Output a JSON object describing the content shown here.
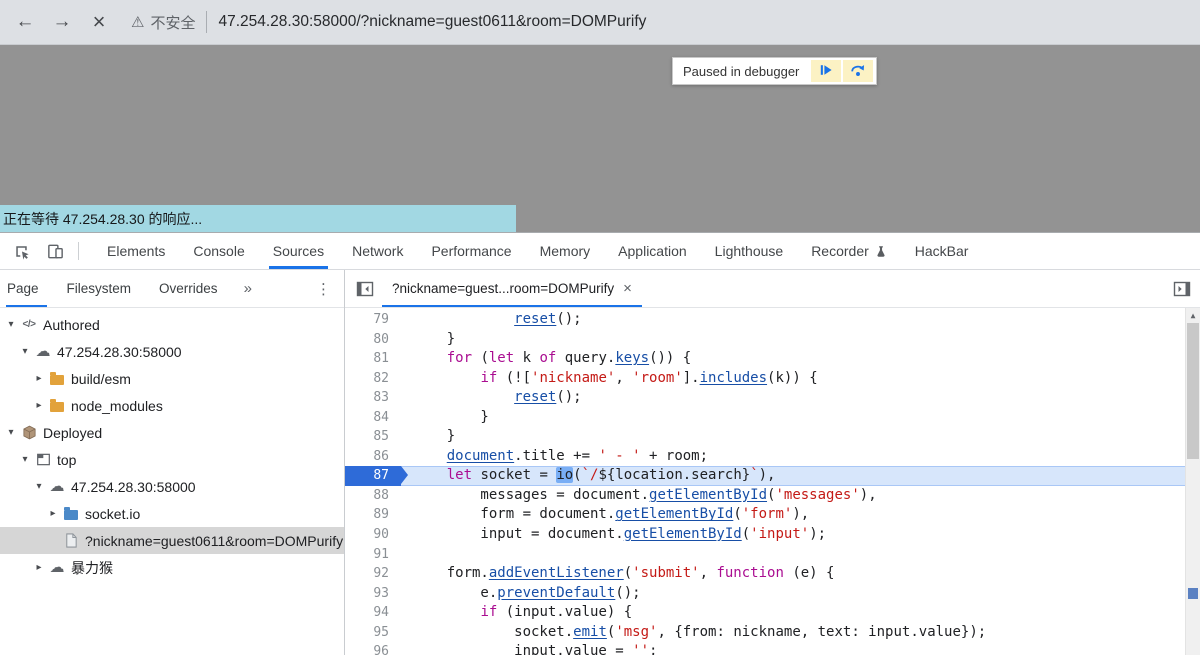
{
  "browser": {
    "security_label": "不安全",
    "url": "47.254.28.30:58000/?nickname=guest0611&room=DOMPurify"
  },
  "page": {
    "paused_label": "Paused in debugger",
    "status_text": "正在等待 47.254.28.30 的响应..."
  },
  "icons": {
    "back": "←",
    "forward": "→",
    "stop": "×",
    "warning": "⚠",
    "overflow": "»",
    "kebab": "⋮",
    "scroll_up": "▲",
    "close": "×"
  },
  "devtools": {
    "main_tabs": [
      {
        "label": "Elements"
      },
      {
        "label": "Console"
      },
      {
        "label": "Sources",
        "active": true
      },
      {
        "label": "Network"
      },
      {
        "label": "Performance"
      },
      {
        "label": "Memory"
      },
      {
        "label": "Application"
      },
      {
        "label": "Lighthouse"
      },
      {
        "label": "Recorder",
        "badge": true
      },
      {
        "label": "HackBar"
      }
    ],
    "sidebar_tabs": [
      {
        "label": "Page",
        "active": true
      },
      {
        "label": "Filesystem"
      },
      {
        "label": "Overrides"
      }
    ],
    "tree": [
      {
        "depth": 0,
        "exp": "▾",
        "icon": "code",
        "label": "Authored"
      },
      {
        "depth": 1,
        "exp": "▾",
        "icon": "cloud",
        "label": "47.254.28.30:58000"
      },
      {
        "depth": 2,
        "exp": "▸",
        "icon": "folder-orange",
        "label": "build/esm"
      },
      {
        "depth": 2,
        "exp": "▸",
        "icon": "folder-orange",
        "label": "node_modules"
      },
      {
        "depth": 0,
        "exp": "▾",
        "icon": "package",
        "label": "Deployed"
      },
      {
        "depth": 1,
        "exp": "▾",
        "icon": "frame",
        "label": "top"
      },
      {
        "depth": 2,
        "exp": "▾",
        "icon": "cloud",
        "label": "47.254.28.30:58000"
      },
      {
        "depth": 3,
        "exp": "▸",
        "icon": "folder-blue",
        "label": "socket.io"
      },
      {
        "depth": 3,
        "exp": "",
        "icon": "file",
        "label": "?nickname=guest0611&room=DOMPurify",
        "selected": true
      },
      {
        "depth": 2,
        "exp": "▸",
        "icon": "cloud",
        "label": "暴力猴"
      }
    ],
    "editor": {
      "tab_label": "?nickname=guest...room=DOMPurify",
      "current_line": 87,
      "code_lines": [
        {
          "n": 79,
          "t": [
            [
              "t",
              "            "
            ],
            [
              "u",
              "reset"
            ],
            [
              "t",
              "();"
            ]
          ]
        },
        {
          "n": 80,
          "t": [
            [
              "t",
              "    }"
            ]
          ]
        },
        {
          "n": 81,
          "t": [
            [
              "t",
              "    "
            ],
            [
              "k",
              "for"
            ],
            [
              "t",
              " ("
            ],
            [
              "k",
              "let"
            ],
            [
              "t",
              " k "
            ],
            [
              "k",
              "of"
            ],
            [
              "t",
              " query."
            ],
            [
              "u",
              "keys"
            ],
            [
              "t",
              "()) {"
            ]
          ]
        },
        {
          "n": 82,
          "t": [
            [
              "t",
              "        "
            ],
            [
              "k",
              "if"
            ],
            [
              "t",
              " (!["
            ],
            [
              "s",
              "'nickname'"
            ],
            [
              "t",
              ", "
            ],
            [
              "s",
              "'room'"
            ],
            [
              "t",
              "]."
            ],
            [
              "u",
              "includes"
            ],
            [
              "t",
              "(k)) {"
            ]
          ]
        },
        {
          "n": 83,
          "t": [
            [
              "t",
              "            "
            ],
            [
              "u",
              "reset"
            ],
            [
              "t",
              "();"
            ]
          ]
        },
        {
          "n": 84,
          "t": [
            [
              "t",
              "        }"
            ]
          ]
        },
        {
          "n": 85,
          "t": [
            [
              "t",
              "    }"
            ]
          ]
        },
        {
          "n": 86,
          "t": [
            [
              "t",
              "    "
            ],
            [
              "u",
              "document"
            ],
            [
              "t",
              ".title += "
            ],
            [
              "s",
              "' - '"
            ],
            [
              "t",
              " + room;"
            ]
          ]
        },
        {
          "n": 87,
          "current": true,
          "t": [
            [
              "t",
              "    "
            ],
            [
              "k",
              "let"
            ],
            [
              "t",
              " socket = "
            ],
            [
              "cur",
              "io"
            ],
            [
              "t",
              "("
            ],
            [
              "s",
              "`/"
            ],
            [
              "t",
              "${location.search}"
            ],
            [
              "s",
              "`"
            ],
            [
              "t",
              "),"
            ]
          ]
        },
        {
          "n": 88,
          "t": [
            [
              "t",
              "        messages = document."
            ],
            [
              "u",
              "getElementById"
            ],
            [
              "t",
              "("
            ],
            [
              "s",
              "'messages'"
            ],
            [
              "t",
              "),"
            ]
          ]
        },
        {
          "n": 89,
          "t": [
            [
              "t",
              "        form = document."
            ],
            [
              "u",
              "getElementById"
            ],
            [
              "t",
              "("
            ],
            [
              "s",
              "'form'"
            ],
            [
              "t",
              "),"
            ]
          ]
        },
        {
          "n": 90,
          "t": [
            [
              "t",
              "        input = document."
            ],
            [
              "u",
              "getElementById"
            ],
            [
              "t",
              "("
            ],
            [
              "s",
              "'input'"
            ],
            [
              "t",
              ");"
            ]
          ]
        },
        {
          "n": 91,
          "t": [
            [
              "t",
              ""
            ]
          ]
        },
        {
          "n": 92,
          "t": [
            [
              "t",
              "    form."
            ],
            [
              "u",
              "addEventListener"
            ],
            [
              "t",
              "("
            ],
            [
              "s",
              "'submit'"
            ],
            [
              "t",
              ", "
            ],
            [
              "k",
              "function"
            ],
            [
              "t",
              " (e) {"
            ]
          ]
        },
        {
          "n": 93,
          "t": [
            [
              "t",
              "        e."
            ],
            [
              "u",
              "preventDefault"
            ],
            [
              "t",
              "();"
            ]
          ]
        },
        {
          "n": 94,
          "t": [
            [
              "t",
              "        "
            ],
            [
              "k",
              "if"
            ],
            [
              "t",
              " (input.value) {"
            ]
          ]
        },
        {
          "n": 95,
          "t": [
            [
              "t",
              "            socket."
            ],
            [
              "u",
              "emit"
            ],
            [
              "t",
              "("
            ],
            [
              "s",
              "'msg'"
            ],
            [
              "t",
              ", {from: nickname, text: input.value});"
            ]
          ]
        },
        {
          "n": 96,
          "t": [
            [
              "t",
              "            input.value = "
            ],
            [
              "s",
              "''"
            ],
            [
              "t",
              ";"
            ]
          ]
        }
      ]
    },
    "colors": {
      "accent": "#1a73e8",
      "keyword": "#aa0d91",
      "string": "#c41a16",
      "linked_identifier": "#174ea6",
      "paused_line_bg": "#d7e6fb",
      "paused_token_bg": "#79aef5",
      "gutter_badge": "#2e6bd8"
    }
  }
}
